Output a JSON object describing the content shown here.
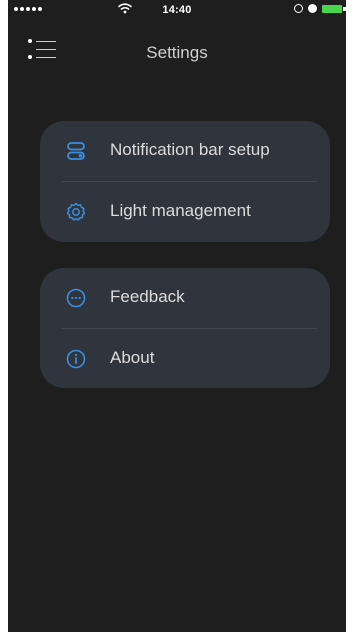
{
  "status_bar": {
    "time": "14:40"
  },
  "nav": {
    "title": "Settings"
  },
  "groups": [
    {
      "items": [
        {
          "label": "Notification bar setup",
          "icon": "toggle-icon"
        },
        {
          "label": "Light management",
          "icon": "gear-icon"
        }
      ]
    },
    {
      "items": [
        {
          "label": "Feedback",
          "icon": "chat-dots-icon"
        },
        {
          "label": "About",
          "icon": "info-icon"
        }
      ]
    }
  ],
  "colors": {
    "background": "#1e1e1f",
    "card": "#30343c",
    "accent": "#3a8fe0",
    "battery": "#47d64c",
    "text": "#dcdcdc"
  }
}
